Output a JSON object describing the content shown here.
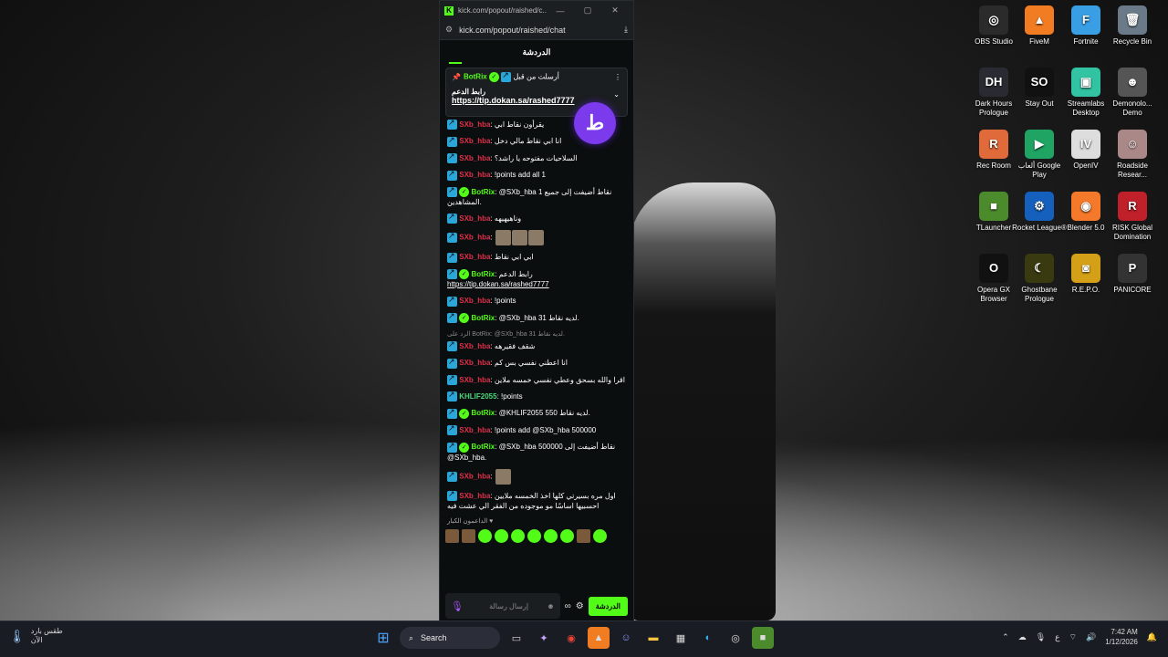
{
  "desktop_icons": [
    {
      "label": "OBS Studio",
      "color": "#2b2b2b",
      "glyph": "◎"
    },
    {
      "label": "FiveM",
      "color": "#f27c22",
      "glyph": "▲"
    },
    {
      "label": "Fortnite",
      "color": "#3a9ee4",
      "glyph": "F"
    },
    {
      "label": "Recycle Bin",
      "color": "#6b7a89",
      "glyph": "🗑"
    },
    {
      "label": "Dark Hours Prologue",
      "color": "#2a2a33",
      "glyph": "DH"
    },
    {
      "label": "Stay Out",
      "color": "#111",
      "glyph": "SO"
    },
    {
      "label": "Streamlabs Desktop",
      "color": "#31c3a2",
      "glyph": "▣"
    },
    {
      "label": "Demonolo... Demo",
      "color": "#555",
      "glyph": "☻"
    },
    {
      "label": "Rec Room",
      "color": "#e06a3a",
      "glyph": "R"
    },
    {
      "label": "ألعاب Google Play",
      "color": "#1fa463",
      "glyph": "▶"
    },
    {
      "label": "OpenIV",
      "color": "#ddd",
      "glyph": "IV"
    },
    {
      "label": "Roadside Resear...",
      "color": "#a88",
      "glyph": "☺"
    },
    {
      "label": "TLauncher",
      "color": "#4c8b2b",
      "glyph": "■"
    },
    {
      "label": "Rocket League®",
      "color": "#1560bd",
      "glyph": "⚙"
    },
    {
      "label": "Blender 5.0",
      "color": "#f5792a",
      "glyph": "◉"
    },
    {
      "label": "RISK Global Domination",
      "color": "#c0202a",
      "glyph": "R"
    },
    {
      "label": "Opera GX Browser",
      "color": "#111",
      "glyph": "O"
    },
    {
      "label": "Ghostbane Prologue",
      "color": "#3a3a10",
      "glyph": "☾"
    },
    {
      "label": "R.E.P.O.",
      "color": "#d4a017",
      "glyph": "◙"
    },
    {
      "label": "PANICORE",
      "color": "#333",
      "glyph": "P"
    }
  ],
  "window": {
    "title": "kick.com/popout/raished/c...",
    "url": "kick.com/popout/raished/chat",
    "tab_label": "الدردشة",
    "min": "—",
    "max": "▢",
    "close": "✕",
    "download": "⤓",
    "tune": "⚙",
    "kick_logo": "K"
  },
  "pinned": {
    "sent_by": "أرسلت من قبل",
    "user": "BotRix",
    "title": "رابط الدعم",
    "link": "https://tip.dokan.sa/rashed7777",
    "pin_icon": "📌",
    "more_icon": "⋮",
    "chevron": "⌄"
  },
  "tip_badge": "ط",
  "messages": [
    {
      "user": "SXb_hba",
      "cls": "u-red",
      "text": "يقرأون نقاط ابي"
    },
    {
      "user": "SXb_hba",
      "cls": "u-red",
      "text": "انا ابي نقاط مالي دخل"
    },
    {
      "user": "SXb_hba",
      "cls": "u-red",
      "text": "السلاحيات مفتوحه يا راشد؟"
    },
    {
      "user": "SXb_hba",
      "cls": "u-red",
      "text": "!points add all 1"
    },
    {
      "user": "BotRix",
      "cls": "u-green",
      "verified": true,
      "text": "@SXb_hba 1 نقاط أضيفت إلى جميع المشاهدين."
    },
    {
      "user": "SXb_hba",
      "cls": "u-red",
      "text": "وناهيهيهه"
    },
    {
      "user": "SXb_hba",
      "cls": "u-red",
      "text": "",
      "emotes": 3
    },
    {
      "user": "SXb_hba",
      "cls": "u-red",
      "text": "ابي ابي نقاط"
    },
    {
      "user": "BotRix",
      "cls": "u-green",
      "verified": true,
      "text": "رابط الدعم",
      "link": "https://tip.dokan.sa/rashed7777"
    },
    {
      "user": "SXb_hba",
      "cls": "u-red",
      "text": "!points"
    },
    {
      "user": "BotRix",
      "cls": "u-green",
      "verified": true,
      "text": "@SXb_hba 31 لديه نقاط."
    },
    {
      "user": "SXb_hba",
      "cls": "u-red",
      "reply": "الرد على BotRix: @SXb_hba 31 لديه نقاط.",
      "text": "شقف فقيرهه"
    },
    {
      "user": "SXb_hba",
      "cls": "u-red",
      "text": "انا اعطني نفسي بس كم"
    },
    {
      "user": "SXb_hba",
      "cls": "u-red",
      "text": "اقرا والله بسحق وعطي نفسي خمسه ملاين"
    },
    {
      "user": "KHLIF2055",
      "cls": "u-green2",
      "text": "!points"
    },
    {
      "user": "BotRix",
      "cls": "u-green",
      "verified": true,
      "text": "@KHLIF2055 550 لديه نقاط."
    },
    {
      "user": "SXb_hba",
      "cls": "u-red",
      "text": "!points add @SXb_hba 500000"
    },
    {
      "user": "BotRix",
      "cls": "u-green",
      "verified": true,
      "text": "@SXb_hba 500000 نقاط أضيفت إلى @SXb_hba."
    },
    {
      "user": "SXb_hba",
      "cls": "u-red",
      "text": "",
      "emotes": 1
    },
    {
      "user": "SXb_hba",
      "cls": "u-red",
      "text": "اول مره بسيرتي كلها اخذ الخمسه ملايين احسبيها اساسًا مو موجوده من الفقر الي عشت فيه"
    }
  ],
  "supporters": "الداعمون الكبار",
  "input": {
    "placeholder": "إرسال رسالة",
    "send": "الدردشة",
    "emoji": "☻",
    "settings": "⚙",
    "infinity": "∞",
    "mic": "🎙"
  },
  "taskbar": {
    "weather_title": "طقس بارد",
    "weather_sub": "الآن",
    "search": "Search",
    "time": "7:42 AM",
    "date": "1/12/2026",
    "lang": "ع"
  }
}
